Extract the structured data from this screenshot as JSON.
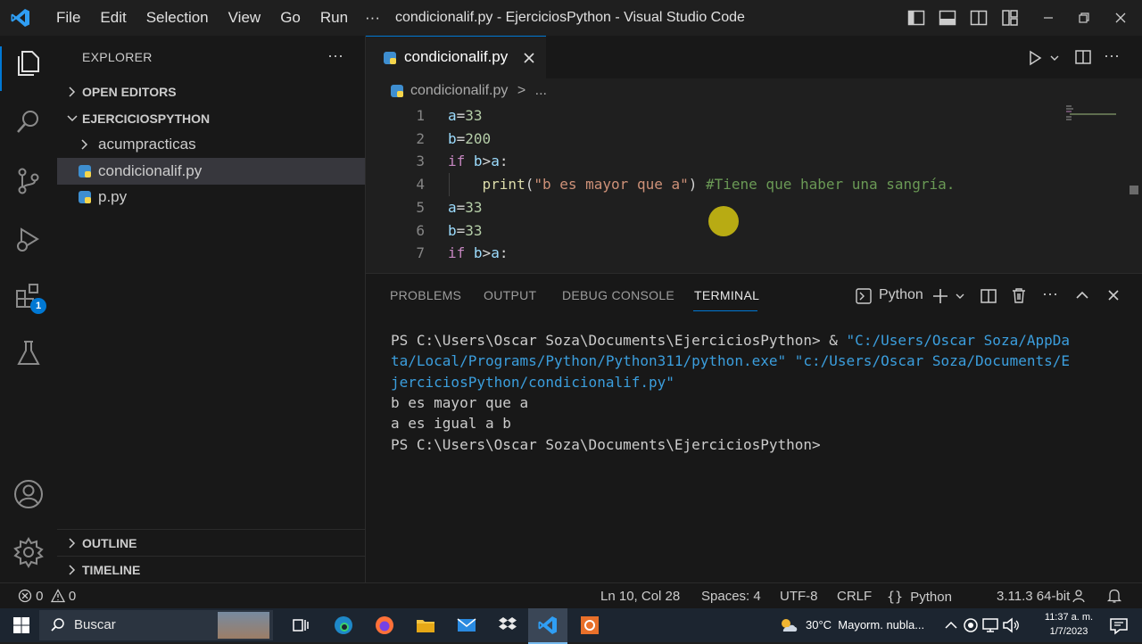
{
  "titlebar": {
    "menu": [
      "File",
      "Edit",
      "Selection",
      "View",
      "Go",
      "Run"
    ],
    "overflow": "···",
    "window_title": "condicionalif.py - EjerciciosPython - Visual Studio Code"
  },
  "activity": {
    "extensions_badge": "1"
  },
  "sidebar": {
    "title": "EXPLORER",
    "more": "···",
    "open_editors": "OPEN EDITORS",
    "project": "EJERCICIOSPYTHON",
    "items": [
      {
        "label": "acumpracticas",
        "type": "folder"
      },
      {
        "label": "condicionalif.py",
        "type": "file",
        "selected": true
      },
      {
        "label": "p.py",
        "type": "file"
      }
    ],
    "outline": "OUTLINE",
    "timeline": "TIMELINE"
  },
  "editor": {
    "tab": "condicionalif.py",
    "breadcrumb_file": "condicionalif.py",
    "breadcrumb_sep": ">",
    "breadcrumb_more": "...",
    "lines": [
      {
        "n": "1",
        "tokens": [
          [
            "var",
            "a"
          ],
          [
            "pn",
            "="
          ],
          [
            "num",
            "33"
          ]
        ]
      },
      {
        "n": "2",
        "tokens": [
          [
            "var",
            "b"
          ],
          [
            "pn",
            "="
          ],
          [
            "num",
            "200"
          ]
        ]
      },
      {
        "n": "3",
        "tokens": [
          [
            "kw",
            "if"
          ],
          [
            "pn",
            " "
          ],
          [
            "var",
            "b"
          ],
          [
            "pn",
            ">"
          ],
          [
            "var",
            "a"
          ],
          [
            "pn",
            ":"
          ]
        ]
      },
      {
        "n": "4",
        "tokens": [
          [
            "pn",
            "    "
          ],
          [
            "fn",
            "print"
          ],
          [
            "pn",
            "("
          ],
          [
            "str",
            "\"b es mayor que a\""
          ],
          [
            "pn",
            ") "
          ],
          [
            "cm",
            "#Tiene que haber una sangría."
          ]
        ]
      },
      {
        "n": "5",
        "tokens": [
          [
            "var",
            "a"
          ],
          [
            "pn",
            "="
          ],
          [
            "num",
            "33"
          ]
        ]
      },
      {
        "n": "6",
        "tokens": [
          [
            "var",
            "b"
          ],
          [
            "pn",
            "="
          ],
          [
            "num",
            "33"
          ]
        ]
      },
      {
        "n": "7",
        "tokens": [
          [
            "kw",
            "if"
          ],
          [
            "pn",
            " "
          ],
          [
            "var",
            "b"
          ],
          [
            "pn",
            ">"
          ],
          [
            "var",
            "a"
          ],
          [
            "pn",
            ":"
          ]
        ]
      }
    ]
  },
  "panel": {
    "tabs": [
      "PROBLEMS",
      "OUTPUT",
      "DEBUG CONSOLE",
      "TERMINAL"
    ],
    "active_tab": "TERMINAL",
    "shell": "Python",
    "terminal": [
      {
        "text": "PS C:\\Users\\Oscar Soza\\Documents\\EjerciciosPython> & ",
        "tail": "\"C:/Users/Oscar Soza/AppDa"
      },
      {
        "text": "",
        "tail": "ta/Local/Programs/Python/Python311/python.exe\" \"c:/Users/Oscar Soza/Documents/E"
      },
      {
        "text": "",
        "tail": "jerciciosPython/condicionalif.py\""
      },
      {
        "text": "b es mayor que a",
        "tail": ""
      },
      {
        "text": "a es igual a b",
        "tail": ""
      },
      {
        "text": "PS C:\\Users\\Oscar Soza\\Documents\\EjerciciosPython>",
        "tail": ""
      }
    ]
  },
  "statusbar": {
    "errors": "0",
    "warnings": "0",
    "position": "Ln 10, Col 28",
    "spaces": "Spaces: 4",
    "encoding": "UTF-8",
    "eol": "CRLF",
    "language": "Python",
    "interpreter": "3.11.3 64-bit"
  },
  "taskbar": {
    "search": "Buscar",
    "weather": "30°C  Mayorm. nubla...",
    "time": "11:37 a. m.",
    "date": "1/7/2023"
  },
  "colors": {
    "accent": "#0078d4",
    "badge": "#0078d4",
    "terminal_string": "#3b9edd"
  }
}
